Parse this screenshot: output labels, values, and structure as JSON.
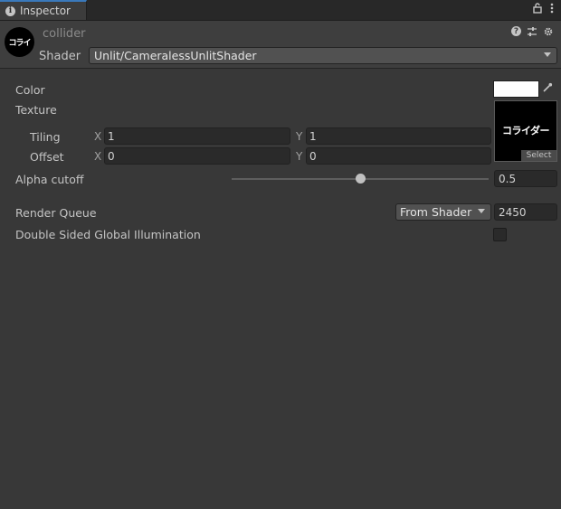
{
  "tab": {
    "title": "Inspector",
    "info_icon": "info-icon"
  },
  "toolbar_icons": [
    "lock-icon",
    "more-vertical-icon"
  ],
  "header": {
    "material_name": "collider",
    "avatar_text": "コライ",
    "shader_label": "Shader",
    "shader_value": "Unlit/CameralessUnlitShader",
    "icons": [
      "help-icon",
      "preset-icon",
      "gear-icon"
    ]
  },
  "properties": {
    "color": {
      "label": "Color",
      "value": "#ffffff"
    },
    "texture": {
      "label": "Texture",
      "thumbnail_text": "コライダー",
      "select_label": "Select",
      "tiling": {
        "label": "Tiling",
        "x_label": "X",
        "x": "1",
        "y_label": "Y",
        "y": "1"
      },
      "offset": {
        "label": "Offset",
        "x_label": "X",
        "x": "0",
        "y_label": "Y",
        "y": "0"
      }
    },
    "alpha_cutoff": {
      "label": "Alpha cutoff",
      "value": "0.5",
      "slider_fraction": 0.5
    },
    "render_queue": {
      "label": "Render Queue",
      "mode": "From Shader",
      "value": "2450"
    },
    "double_sided_gi": {
      "label": "Double Sided Global Illumination",
      "checked": false
    }
  },
  "colors": {
    "accent": "#3a79bb",
    "background": "#383838",
    "field": "#2a2a2a"
  }
}
